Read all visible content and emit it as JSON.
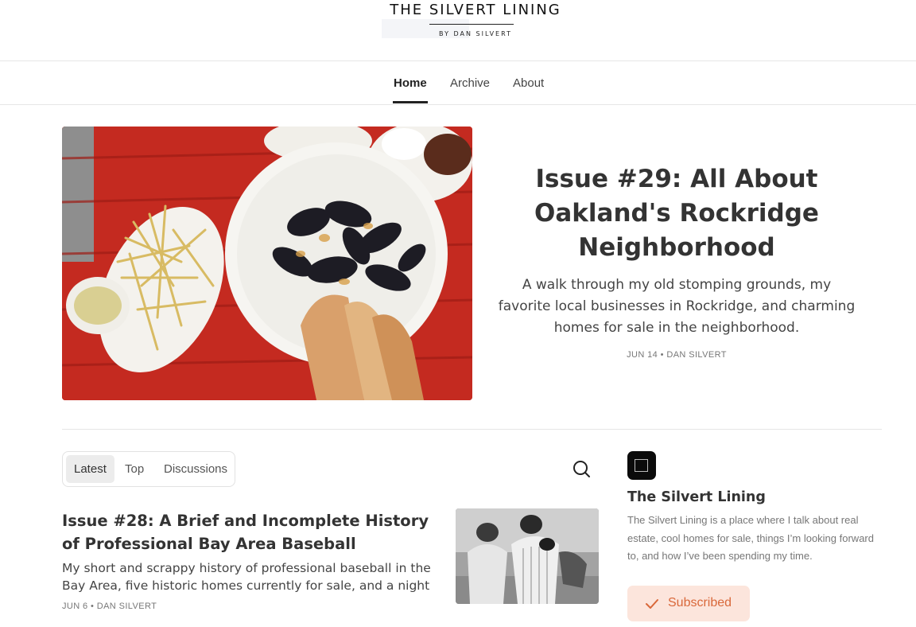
{
  "publication": {
    "name": "THE SILVERT LINING",
    "byline": "BY DAN SILVERT"
  },
  "nav": {
    "items": [
      {
        "label": "Home",
        "active": true
      },
      {
        "label": "Archive"
      },
      {
        "label": "About"
      }
    ]
  },
  "hero": {
    "title": "Issue #29: All About Oakland's Rockridge Neighborhood",
    "subtitle": "A walk through my old stomping grounds, my favorite local businesses in Rockridge, and charming homes for sale in the neighborhood.",
    "meta": "JUN 14 • DAN SILVERT",
    "image_icon": "mussels-and-fries-photo"
  },
  "feed": {
    "tabs": [
      {
        "label": "Latest",
        "active": true
      },
      {
        "label": "Top"
      },
      {
        "label": "Discussions"
      }
    ],
    "search_icon": "search-icon"
  },
  "posts": [
    {
      "title": "Issue #28: A Brief and Incomplete History of Professional Bay Area Baseball",
      "subtitle": "My short and scrappy history of professional baseball in the Bay Area, five historic homes currently for sale, and a night of...",
      "meta": "JUN 6 • DAN SILVERT",
      "image_icon": "vintage-baseball-photo"
    }
  ],
  "sidebar": {
    "title": "The Silvert Lining",
    "description": "The Silvert Lining is a place where I talk about real estate, cool homes for sale, things I’m looking forward to, and how I’ve been spending my time.",
    "subscribe_label": "Subscribed",
    "accent": "#d9683a",
    "button_bg": "#fce5dc"
  }
}
